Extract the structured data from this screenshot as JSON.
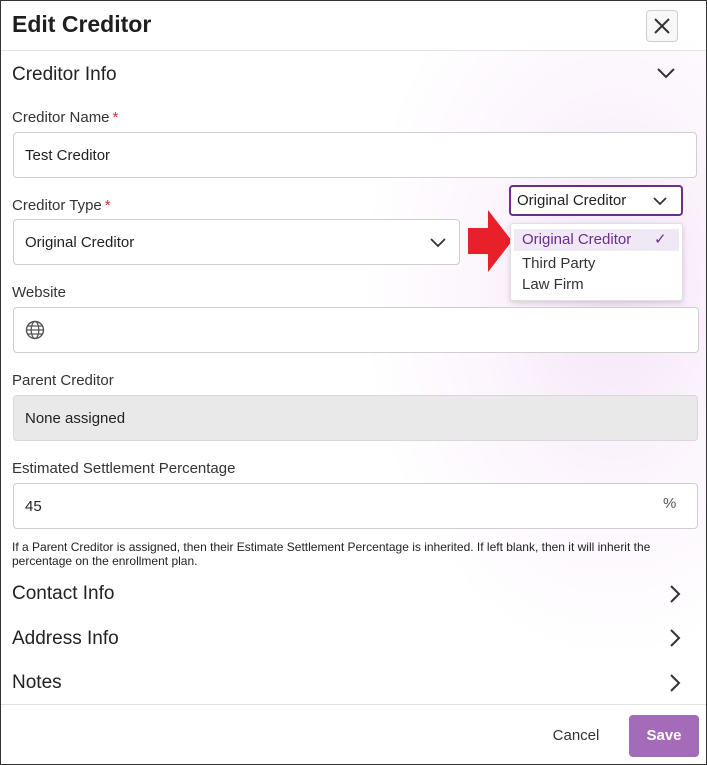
{
  "dialog": {
    "title": "Edit Creditor"
  },
  "creditor_info": {
    "section_title": "Creditor Info",
    "creditor_name": {
      "label": "Creditor Name",
      "required_mark": "*",
      "value": "Test Creditor"
    },
    "creditor_type": {
      "label": "Creditor Type",
      "required_mark": "*",
      "value": "Original Creditor",
      "popup_value": "Original Creditor",
      "options": [
        "Original Creditor",
        "Third Party",
        "Law Firm"
      ],
      "selected_check": "✓"
    },
    "website": {
      "label": "Website",
      "value": ""
    },
    "parent_creditor": {
      "label": "Parent Creditor",
      "value": "None assigned"
    },
    "settlement": {
      "label": "Estimated Settlement Percentage",
      "value": "45",
      "unit_icon": "%"
    },
    "help_text": "If a Parent Creditor is assigned, then their Estimate Settlement Percentage is inherited. If left blank, then it will inherit the percentage on the enrollment plan."
  },
  "sections": {
    "contact": "Contact Info",
    "address": "Address Info",
    "notes": "Notes"
  },
  "footer": {
    "cancel": "Cancel",
    "save": "Save"
  },
  "colors": {
    "accent": "#6b2d8e",
    "save_button": "#a46cb8",
    "annotation_arrow": "#e8202a"
  },
  "icons": {
    "close": "close-icon",
    "chevron_down": "chevron-down-icon",
    "chevron_right": "chevron-right-icon",
    "globe": "globe-icon",
    "percent": "percent-icon",
    "annotation_arrow": "red-arrow-icon"
  }
}
